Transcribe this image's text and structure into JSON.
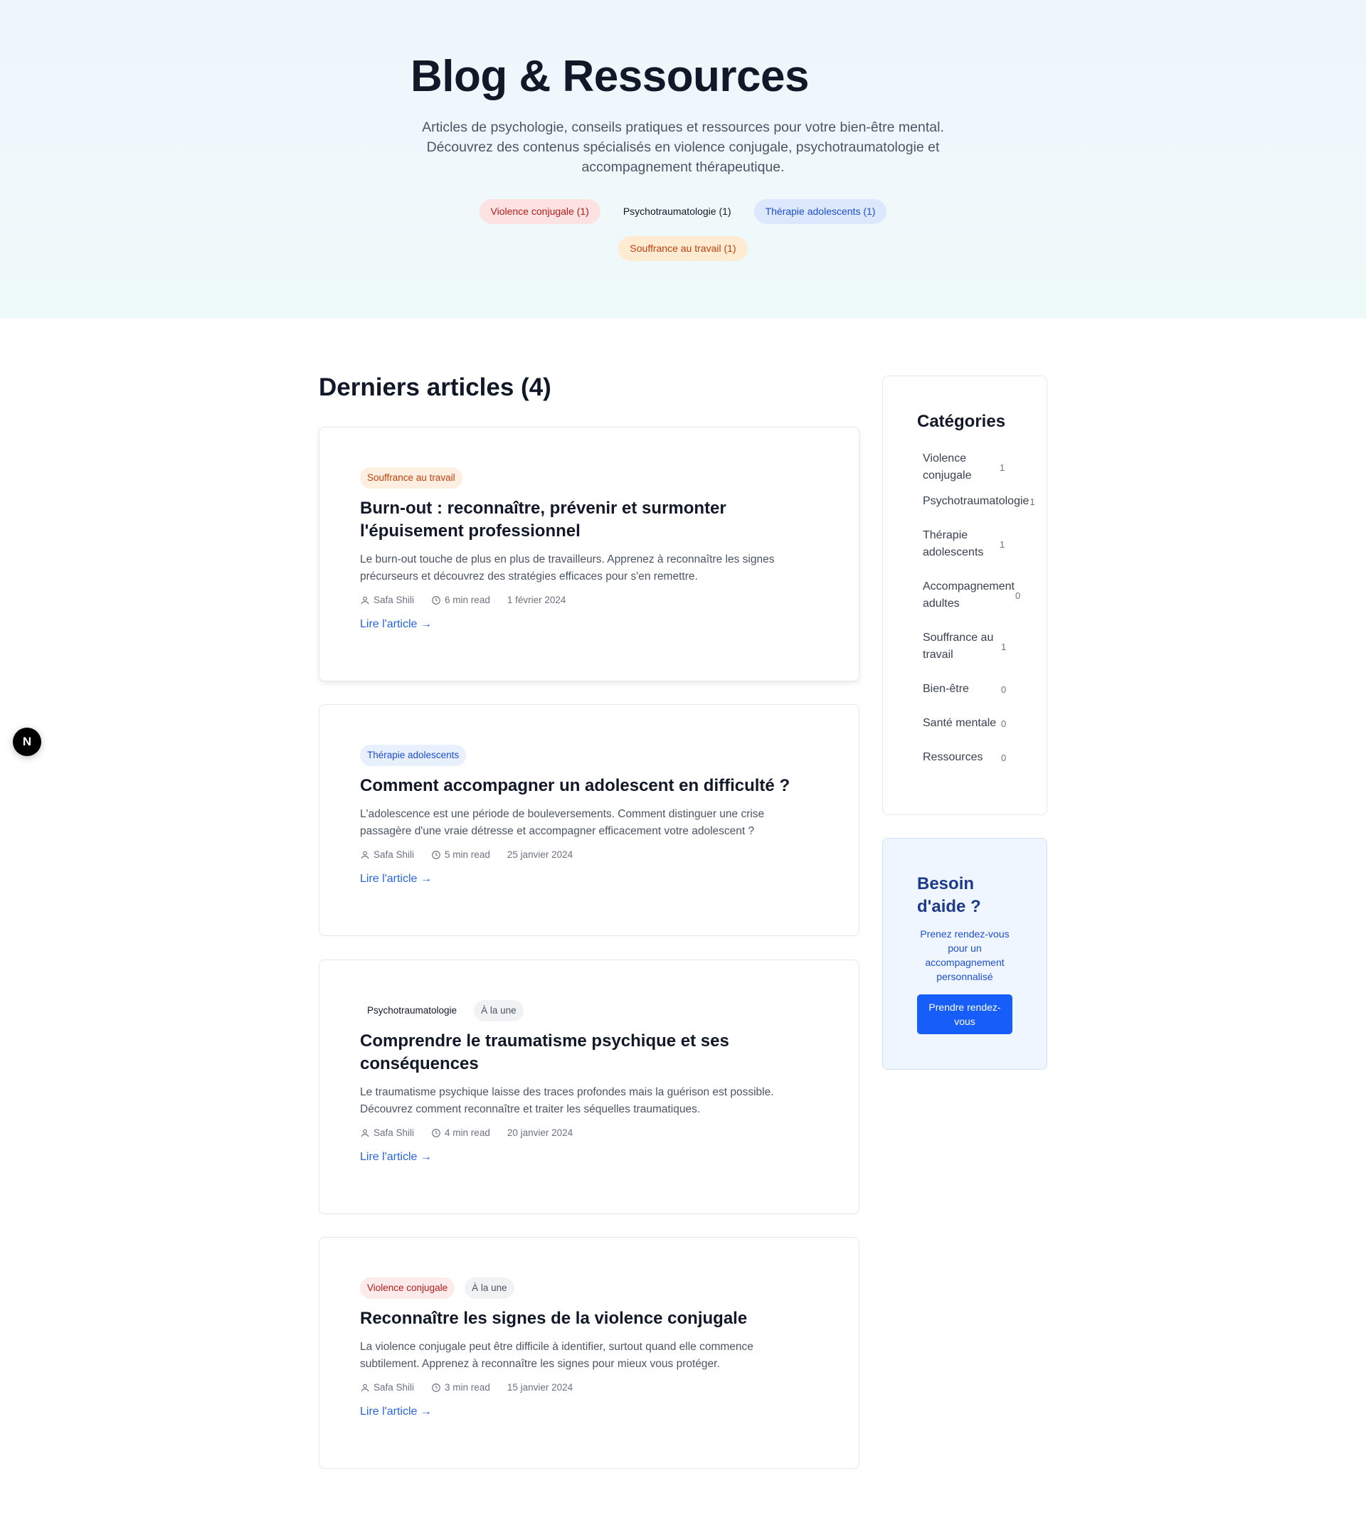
{
  "hero": {
    "title": "Blog & Ressources",
    "description": "Articles de psychologie, conseils pratiques et ressources pour votre bien-être mental. Découvrez des contenus spécialisés en violence conjugale, psychotraumatologie et accompagnement thérapeutique.",
    "tags": [
      {
        "label": "Violence conjugale (1)",
        "color": "red"
      },
      {
        "label": "Psychotraumatologie (1)",
        "color": "plain"
      },
      {
        "label": "Thérapie adolescents (1)",
        "color": "blue"
      },
      {
        "label": "Souffrance au travail (1)",
        "color": "orange"
      }
    ]
  },
  "main": {
    "section_title": "Derniers articles (4)",
    "articles": [
      {
        "badges": [
          {
            "label": "Souffrance au travail",
            "color": "orange"
          }
        ],
        "title": "Burn-out : reconnaître, prévenir et surmonter l'épuisement professionnel",
        "excerpt": "Le burn-out touche de plus en plus de travailleurs. Apprenez à reconnaître les signes précurseurs et découvrez des stratégies efficaces pour s'en remettre.",
        "author": "Safa Shili",
        "read_time": "6 min read",
        "date": "1 février 2024",
        "link": "Lire l'article →"
      },
      {
        "badges": [
          {
            "label": "Thérapie adolescents",
            "color": "blue"
          }
        ],
        "title": "Comment accompagner un adolescent en difficulté ?",
        "excerpt": "L'adolescence est une période de bouleversements. Comment distinguer une crise passagère d'une vraie détresse et accompagner efficacement votre adolescent ?",
        "author": "Safa Shili",
        "read_time": "5 min read",
        "date": "25 janvier 2024",
        "link": "Lire l'article →"
      },
      {
        "badges": [
          {
            "label": "Psychotraumatologie",
            "color": "plain"
          },
          {
            "label": "À la une",
            "color": "gray"
          }
        ],
        "title": "Comprendre le traumatisme psychique et ses conséquences",
        "excerpt": "Le traumatisme psychique laisse des traces profondes mais la guérison est possible. Découvrez comment reconnaître et traiter les séquelles traumatiques.",
        "author": "Safa Shili",
        "read_time": "4 min read",
        "date": "20 janvier 2024",
        "link": "Lire l'article →"
      },
      {
        "badges": [
          {
            "label": "Violence conjugale",
            "color": "red"
          },
          {
            "label": "À la une",
            "color": "gray"
          }
        ],
        "title": "Reconnaître les signes de la violence conjugale",
        "excerpt": "La violence conjugale peut être difficile à identifier, surtout quand elle commence subtilement. Apprenez à reconnaître les signes pour mieux vous protéger.",
        "author": "Safa Shili",
        "read_time": "3 min read",
        "date": "15 janvier 2024",
        "link": "Lire l'article →"
      }
    ]
  },
  "sidebar": {
    "categories_title": "Catégories",
    "categories": [
      {
        "name": "Violence conjugale",
        "count": "1"
      },
      {
        "name": "Psychotraumatologie",
        "count": "1"
      },
      {
        "name": "Thérapie adolescents",
        "count": "1"
      },
      {
        "name": "Accompagnement adultes",
        "count": "0"
      },
      {
        "name": "Souffrance au travail",
        "count": "1"
      },
      {
        "name": "Bien-être",
        "count": "0"
      },
      {
        "name": "Santé mentale",
        "count": "0"
      },
      {
        "name": "Ressources",
        "count": "0"
      }
    ],
    "help": {
      "title": "Besoin d'aide ?",
      "text": "Prenez rendez-vous pour un accompagnement personnalisé",
      "button": "Prendre rendez-vous"
    }
  },
  "floating_button": {
    "label": "N"
  },
  "colors": {
    "accent": "#2563eb",
    "button": "#165dfa"
  }
}
